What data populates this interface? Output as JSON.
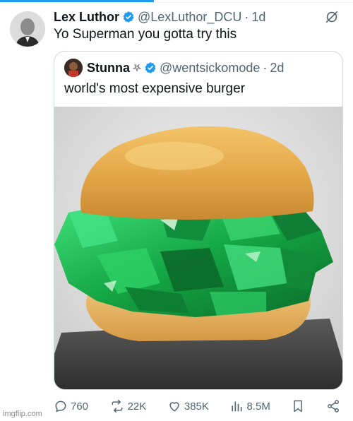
{
  "tweet": {
    "author_name": "Lex Luthor",
    "handle": "@LexLuthor_DCU",
    "time": "1d",
    "text": "Yo Superman you gotta try this"
  },
  "quoted_tweet": {
    "author_name": "Stunna",
    "emoji": "⛧",
    "handle": "@wentsickomode",
    "time": "2d",
    "text": "world's most expensive burger"
  },
  "actions": {
    "replies": "760",
    "reposts": "22K",
    "likes": "385K",
    "views": "8.5M"
  },
  "colors": {
    "accent": "#1d9bf0",
    "muted": "#536471",
    "text": "#0f1419",
    "emerald": "#1fb24a"
  },
  "watermark": "imgflip.com"
}
